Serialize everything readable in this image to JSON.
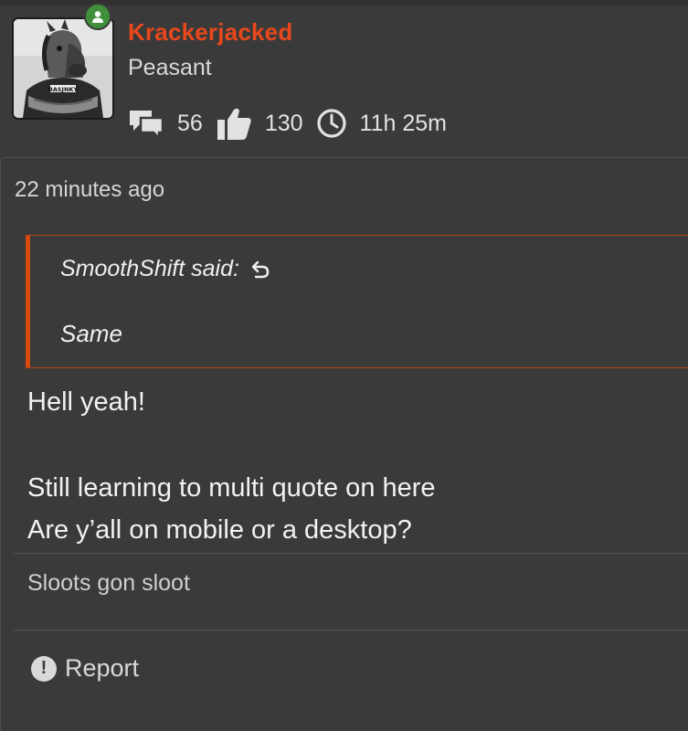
{
  "user": {
    "name": "Krackerjacked",
    "title": "Peasant",
    "name_color": "#e8481c",
    "online_indicator_color": "#3f8f3b",
    "avatar_icon": "horse-mask-avatar",
    "avatar_shirt_text": "BASJNKY"
  },
  "stats": {
    "messages": "56",
    "reactions": "130",
    "time": "11h 25m",
    "icons": [
      "comments-icon",
      "thumbs-up-icon",
      "clock-icon"
    ]
  },
  "post": {
    "timestamp": "22 minutes ago",
    "quote": {
      "attribution": "SmoothShift said:",
      "text": "Same",
      "border_color": "#d8490f"
    },
    "body": [
      "Hell yeah!",
      "Still learning to multi quote on here",
      "Are y’all on mobile or a desktop?"
    ],
    "signature": "Sloots gon sloot",
    "report_label": "Report"
  }
}
